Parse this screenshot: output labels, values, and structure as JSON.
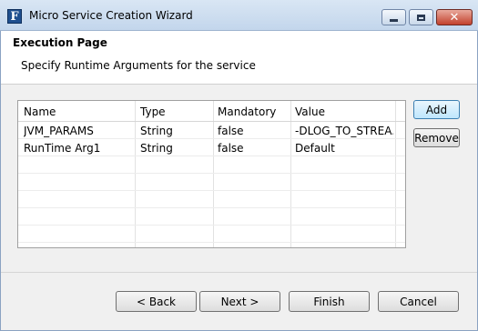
{
  "window": {
    "title": "Micro Service Creation Wizard",
    "app_icon_letter": "F"
  },
  "header": {
    "title": "Execution Page",
    "subtitle": "Specify Runtime Arguments for the service"
  },
  "table": {
    "columns": [
      "Name",
      "Type",
      "Mandatory",
      "Value"
    ],
    "rows": [
      [
        "JVM_PARAMS",
        "String",
        "false",
        "-DLOG_TO_STREA..."
      ],
      [
        "RunTime Arg1",
        "String",
        "false",
        "Default"
      ]
    ]
  },
  "side_buttons": {
    "add": "Add",
    "remove": "Remove"
  },
  "nav_buttons": {
    "back": "< Back",
    "next": "Next >",
    "finish": "Finish",
    "cancel": "Cancel"
  },
  "colors": {
    "titlebar": "#c9daee",
    "close_button": "#c2412d",
    "default_button_border": "#3c7fb1"
  },
  "icons": [
    "app-logo-icon",
    "minimize-icon",
    "maximize-icon",
    "close-icon"
  ]
}
